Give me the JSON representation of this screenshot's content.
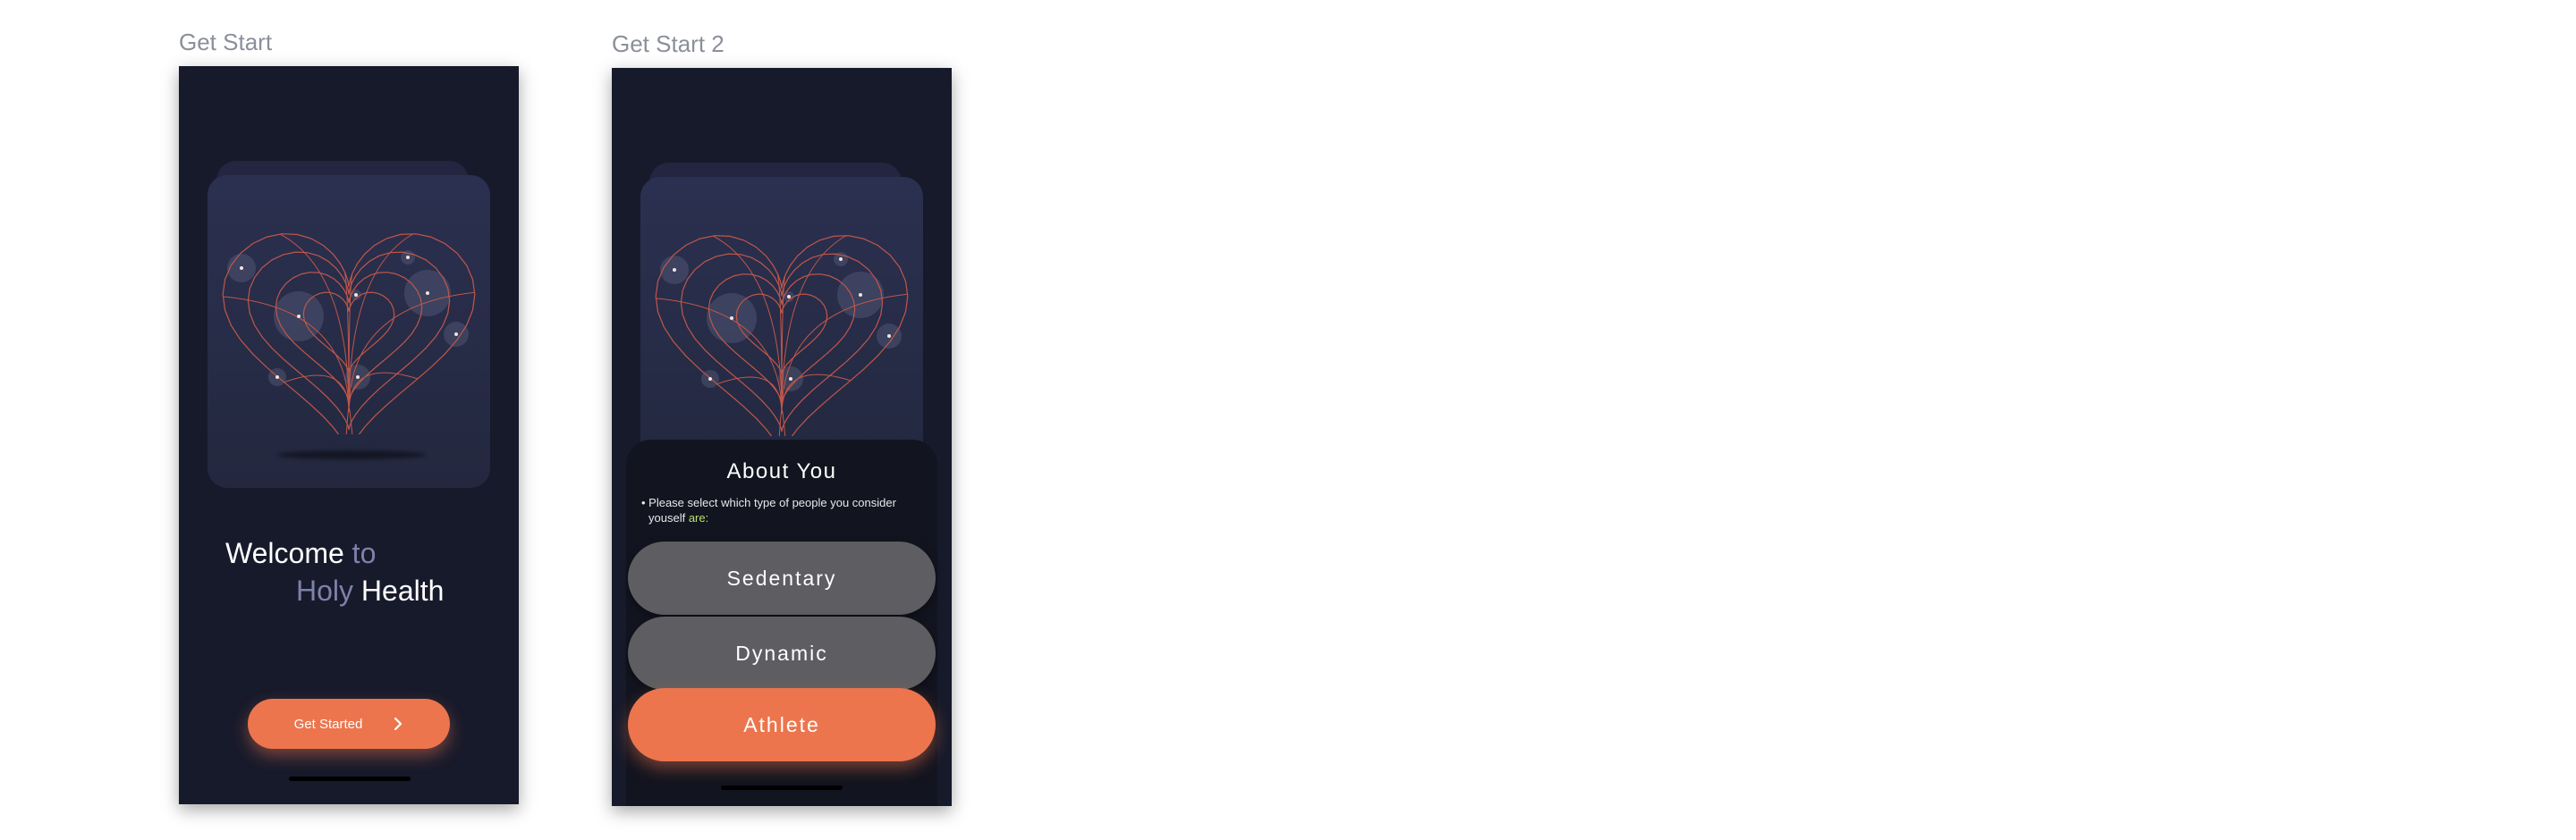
{
  "frames": [
    {
      "label": "Get Start",
      "welcome": {
        "line1_a": "Welcome",
        "line1_b": "to",
        "line2_a": "Holy",
        "line2_b": "Health"
      },
      "cta": {
        "label": "Get Started",
        "icon": "chevron-right-icon"
      },
      "illustration": "wireframe-heart-illustration"
    },
    {
      "label": "Get Start 2",
      "sheet": {
        "title": "About You",
        "description_prefix": "• Please select which type of people you consider yousel",
        "description_text": "• Please select which type of people you consider",
        "description_line2": "youself",
        "description_accent": "are:",
        "options": [
          {
            "label": "Sedentary",
            "selected": false
          },
          {
            "label": "Dynamic",
            "selected": false
          },
          {
            "label": "Athlete",
            "selected": true
          }
        ]
      },
      "illustration": "wireframe-heart-illustration"
    }
  ],
  "colors": {
    "phone_bg": "#171a2b",
    "accent": "#ec754d",
    "muted_text": "#7d82aa",
    "option_gray": "#5e5e62",
    "highlight_green": "#b8e06a"
  }
}
